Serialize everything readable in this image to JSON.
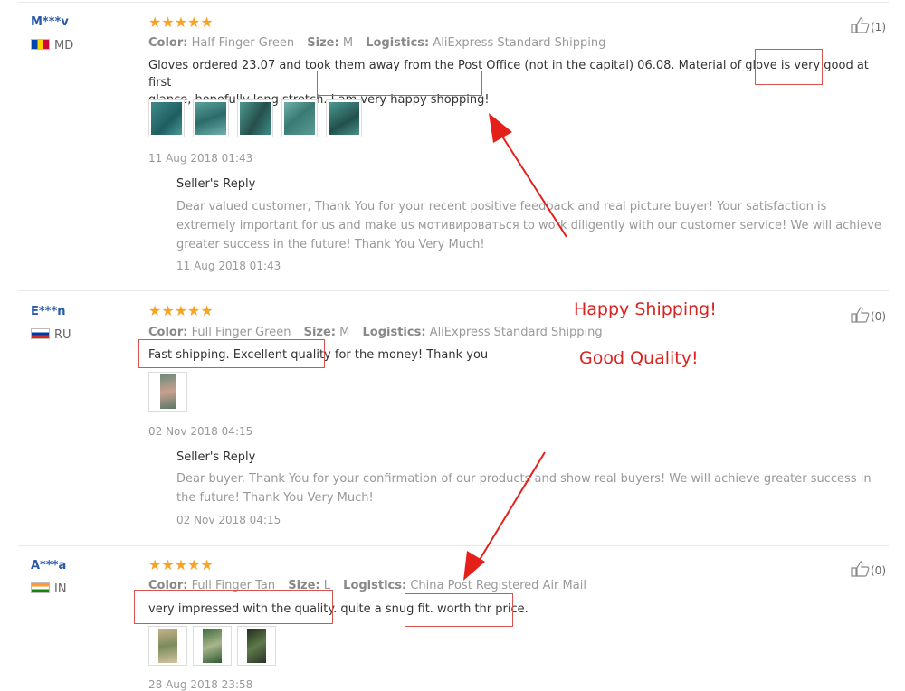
{
  "reviews": [
    {
      "user": "M***v",
      "country": "MD",
      "stars": "★★★★★",
      "color_label": "Color:",
      "color_value": "Half Finger Green",
      "size_label": "Size:",
      "size_value": "M",
      "logistics_label": "Logistics:",
      "logistics_value": "AliExpress Standard Shipping",
      "text_line1": "Gloves ordered 23.07 and took them away from the Post Office (not in the capital) 06.08. Material of glove is very good at first",
      "text_line2": "glance, hopefully long stretch. I am very happy shopping!",
      "date": "11 Aug 2018 01:43",
      "like_count": "(1)",
      "reply_title": "Seller's Reply",
      "reply_text": "Dear valued customer, Thank You for your recent positive feedback and real picture buyer! Your satisfaction is extremely important for us and make us мотивироваться to work diligently with our customer service! We will achieve greater success in the future! Thank You Very Much!",
      "reply_date": "11 Aug 2018 01:43"
    },
    {
      "user": "E***n",
      "country": "RU",
      "stars": "★★★★★",
      "color_label": "Color:",
      "color_value": "Full Finger Green",
      "size_label": "Size:",
      "size_value": "M",
      "logistics_label": "Logistics:",
      "logistics_value": "AliExpress Standard Shipping",
      "text_line1": "Fast shipping. Excellent quality for the money! Thank you",
      "date": "02 Nov 2018 04:15",
      "like_count": "(0)",
      "reply_title": "Seller's Reply",
      "reply_text": "Dear buyer. Thank You for your confirmation of our products and show real buyers! We will achieve greater success in the future! Thank You Very Much!",
      "reply_date": "02 Nov 2018 04:15"
    },
    {
      "user": "A***a",
      "country": "IN",
      "stars": "★★★★★",
      "color_label": "Color:",
      "color_value": "Full Finger Tan",
      "size_label": "Size:",
      "size_value": "L",
      "logistics_label": "Logistics:",
      "logistics_value": "China Post Registered Air Mail",
      "text_line1": "very impressed with the quality. quite a snug fit. worth thr price.",
      "date": "28 Aug 2018 23:58",
      "like_count": "(0)"
    }
  ],
  "annotations": {
    "happy_shipping": "Happy Shipping!",
    "good_quality": "Good Quality!"
  },
  "colors": {
    "star": "#f7a326",
    "username": "#2a5aa8",
    "annotation_red": "#d9231e"
  },
  "icons": [
    "thumbs-up-icon",
    "flag-icon",
    "star-icon"
  ]
}
